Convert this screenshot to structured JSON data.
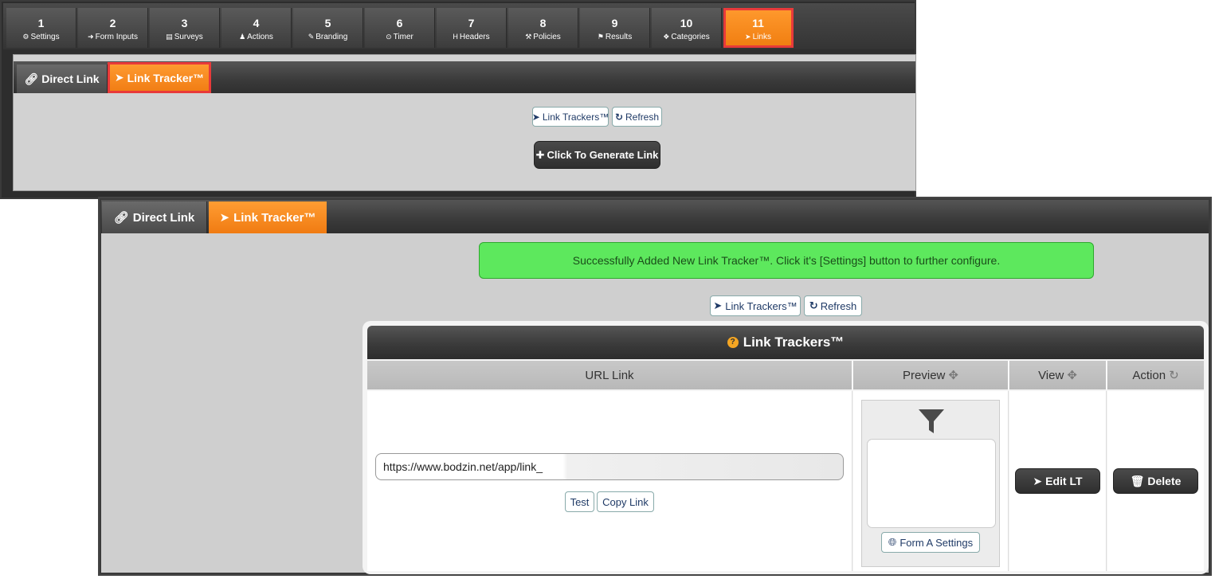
{
  "steps": [
    {
      "num": "1",
      "label": "Settings",
      "icon": "gear-icon",
      "glyph": "⚙"
    },
    {
      "num": "2",
      "label": "Form Inputs",
      "icon": "sign-in-icon",
      "glyph": "➜"
    },
    {
      "num": "3",
      "label": "Surveys",
      "icon": "list-icon",
      "glyph": "▤"
    },
    {
      "num": "4",
      "label": "Actions",
      "icon": "user-icon",
      "glyph": "♟"
    },
    {
      "num": "5",
      "label": "Branding",
      "icon": "brush-icon",
      "glyph": "✎"
    },
    {
      "num": "6",
      "label": "Timer",
      "icon": "clock-icon",
      "glyph": "⊙"
    },
    {
      "num": "7",
      "label": "Headers",
      "icon": "header-icon",
      "glyph": "H"
    },
    {
      "num": "8",
      "label": "Policies",
      "icon": "gavel-icon",
      "glyph": "⚒"
    },
    {
      "num": "9",
      "label": "Results",
      "icon": "flag-icon",
      "glyph": "⚑"
    },
    {
      "num": "10",
      "label": "Categories",
      "icon": "cubes-icon",
      "glyph": "❖"
    },
    {
      "num": "11",
      "label": "Links",
      "icon": "pointer-icon",
      "glyph": "➤"
    }
  ],
  "active_step": "11",
  "top": {
    "tab_direct": "Direct Link",
    "tab_tracker": "Link Tracker™",
    "btn_trackers": "Link Trackers™",
    "btn_refresh": "Refresh",
    "btn_generate": "Click To Generate Link"
  },
  "bottom": {
    "tab_direct": "Direct Link",
    "tab_tracker": "Link Tracker™",
    "alert": "Successfully Added New Link Tracker™. Click it's [Settings] button to further configure.",
    "btn_trackers": "Link Trackers™",
    "btn_refresh": "Refresh",
    "card_title": "Link Trackers™",
    "columns": {
      "url": "URL Link",
      "preview": "Preview",
      "view": "View",
      "action": "Action"
    },
    "url_value": "https://www.bodzin.net/app/link_",
    "btn_test": "Test",
    "btn_copy": "Copy Link",
    "btn_form_settings": "Form A Settings",
    "btn_edit": "Edit LT",
    "btn_delete": "Delete"
  },
  "colors": {
    "accent": "#f58a1f",
    "highlight": "#e83a3a",
    "success": "#5de85d"
  }
}
